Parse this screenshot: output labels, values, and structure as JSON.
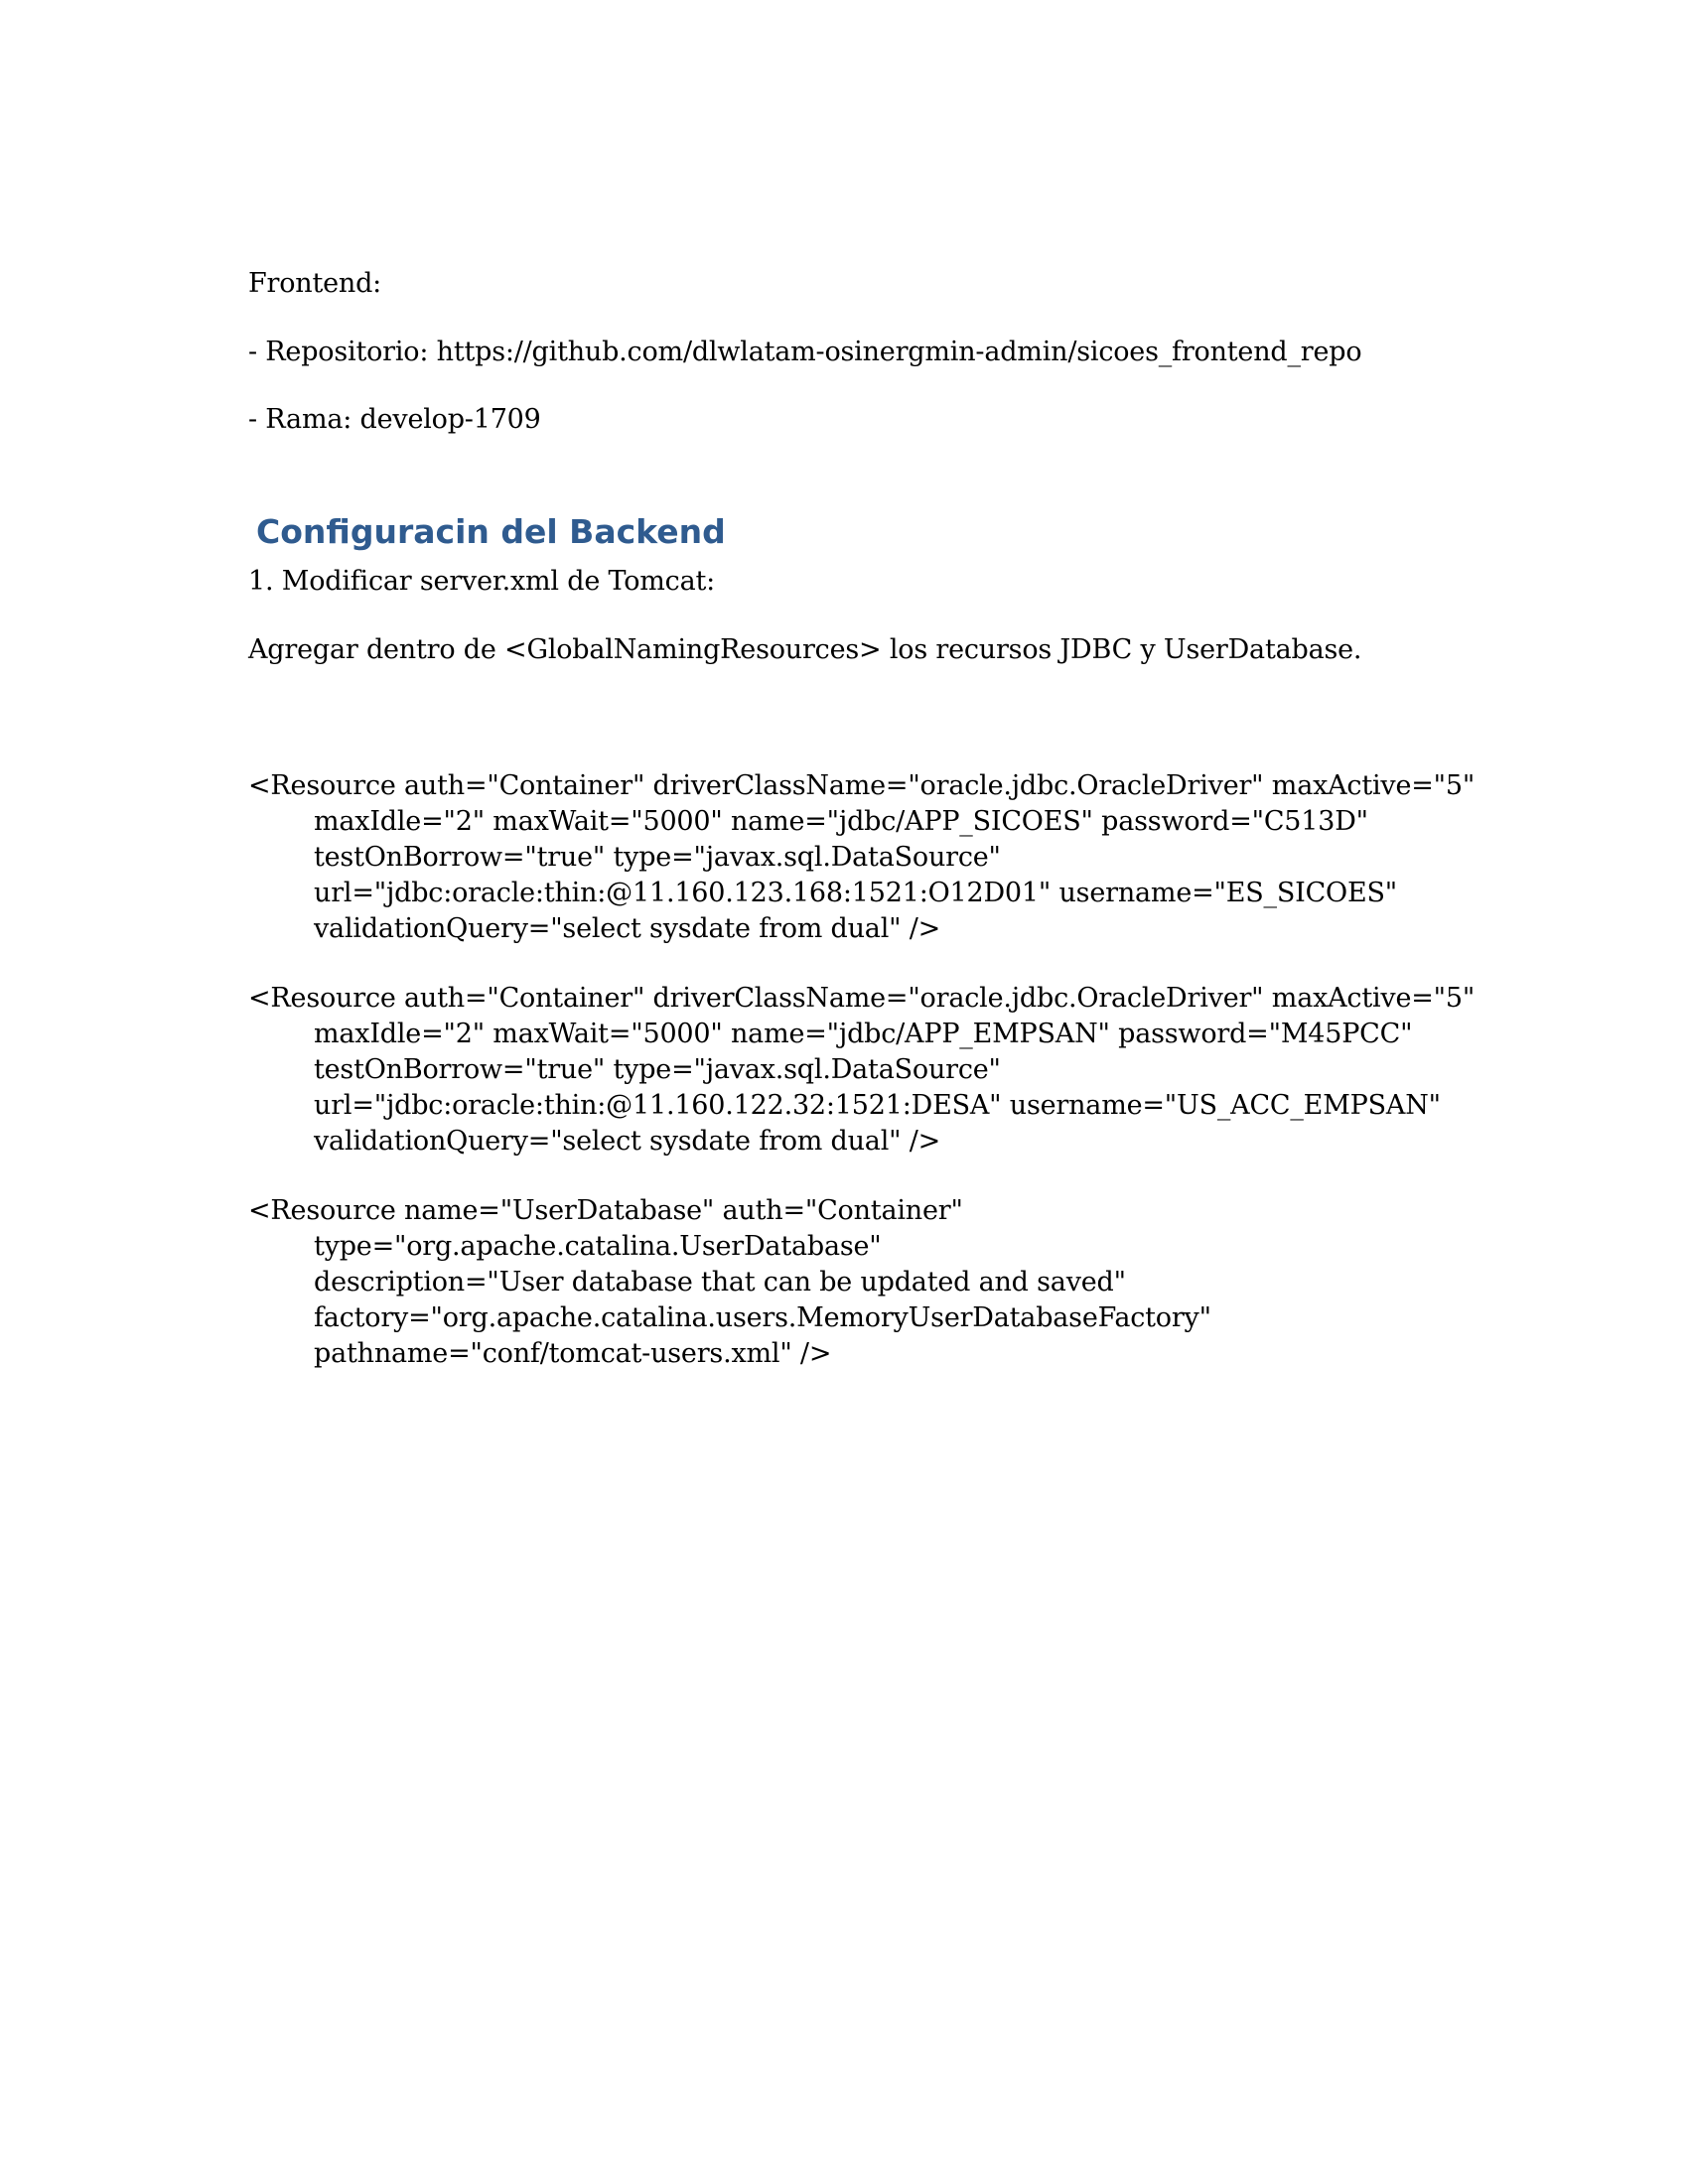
{
  "frontend": {
    "title": "Frontend:",
    "repo_line": "- Repositorio: https://github.com/dlwlatam-osinergmin-admin/sicoes_frontend_repo",
    "branch_line": "- Rama: develop-1709"
  },
  "backend": {
    "heading": "Configuracin del Backend",
    "step1": "1. Modificar server.xml de Tomcat:",
    "instruction": "Agregar dentro de <GlobalNamingResources> los recursos JDBC y UserDatabase."
  },
  "resources": [
    {
      "lines": [
        "<Resource auth=\"Container\" driverClassName=\"oracle.jdbc.OracleDriver\" maxActive=\"5\"",
        "maxIdle=\"2\" maxWait=\"5000\" name=\"jdbc/APP_SICOES\" password=\"C513D\"",
        "testOnBorrow=\"true\" type=\"javax.sql.DataSource\"",
        "url=\"jdbc:oracle:thin:@11.160.123.168:1521:O12D01\" username=\"ES_SICOES\"",
        "validationQuery=\"select sysdate from dual\" />"
      ]
    },
    {
      "lines": [
        "<Resource auth=\"Container\" driverClassName=\"oracle.jdbc.OracleDriver\" maxActive=\"5\"",
        "maxIdle=\"2\" maxWait=\"5000\" name=\"jdbc/APP_EMPSAN\" password=\"M45PCC\"",
        "testOnBorrow=\"true\" type=\"javax.sql.DataSource\"",
        "url=\"jdbc:oracle:thin:@11.160.122.32:1521:DESA\" username=\"US_ACC_EMPSAN\"",
        "validationQuery=\"select sysdate from dual\" />"
      ]
    },
    {
      "lines": [
        "<Resource name=\"UserDatabase\" auth=\"Container\"",
        "type=\"org.apache.catalina.UserDatabase\"",
        "description=\"User database that can be updated and saved\"",
        "factory=\"org.apache.catalina.users.MemoryUserDatabaseFactory\"",
        "pathname=\"conf/tomcat-users.xml\" />"
      ]
    }
  ],
  "colors": {
    "heading": "#2f5b8f",
    "text": "#000000",
    "background": "#ffffff"
  }
}
